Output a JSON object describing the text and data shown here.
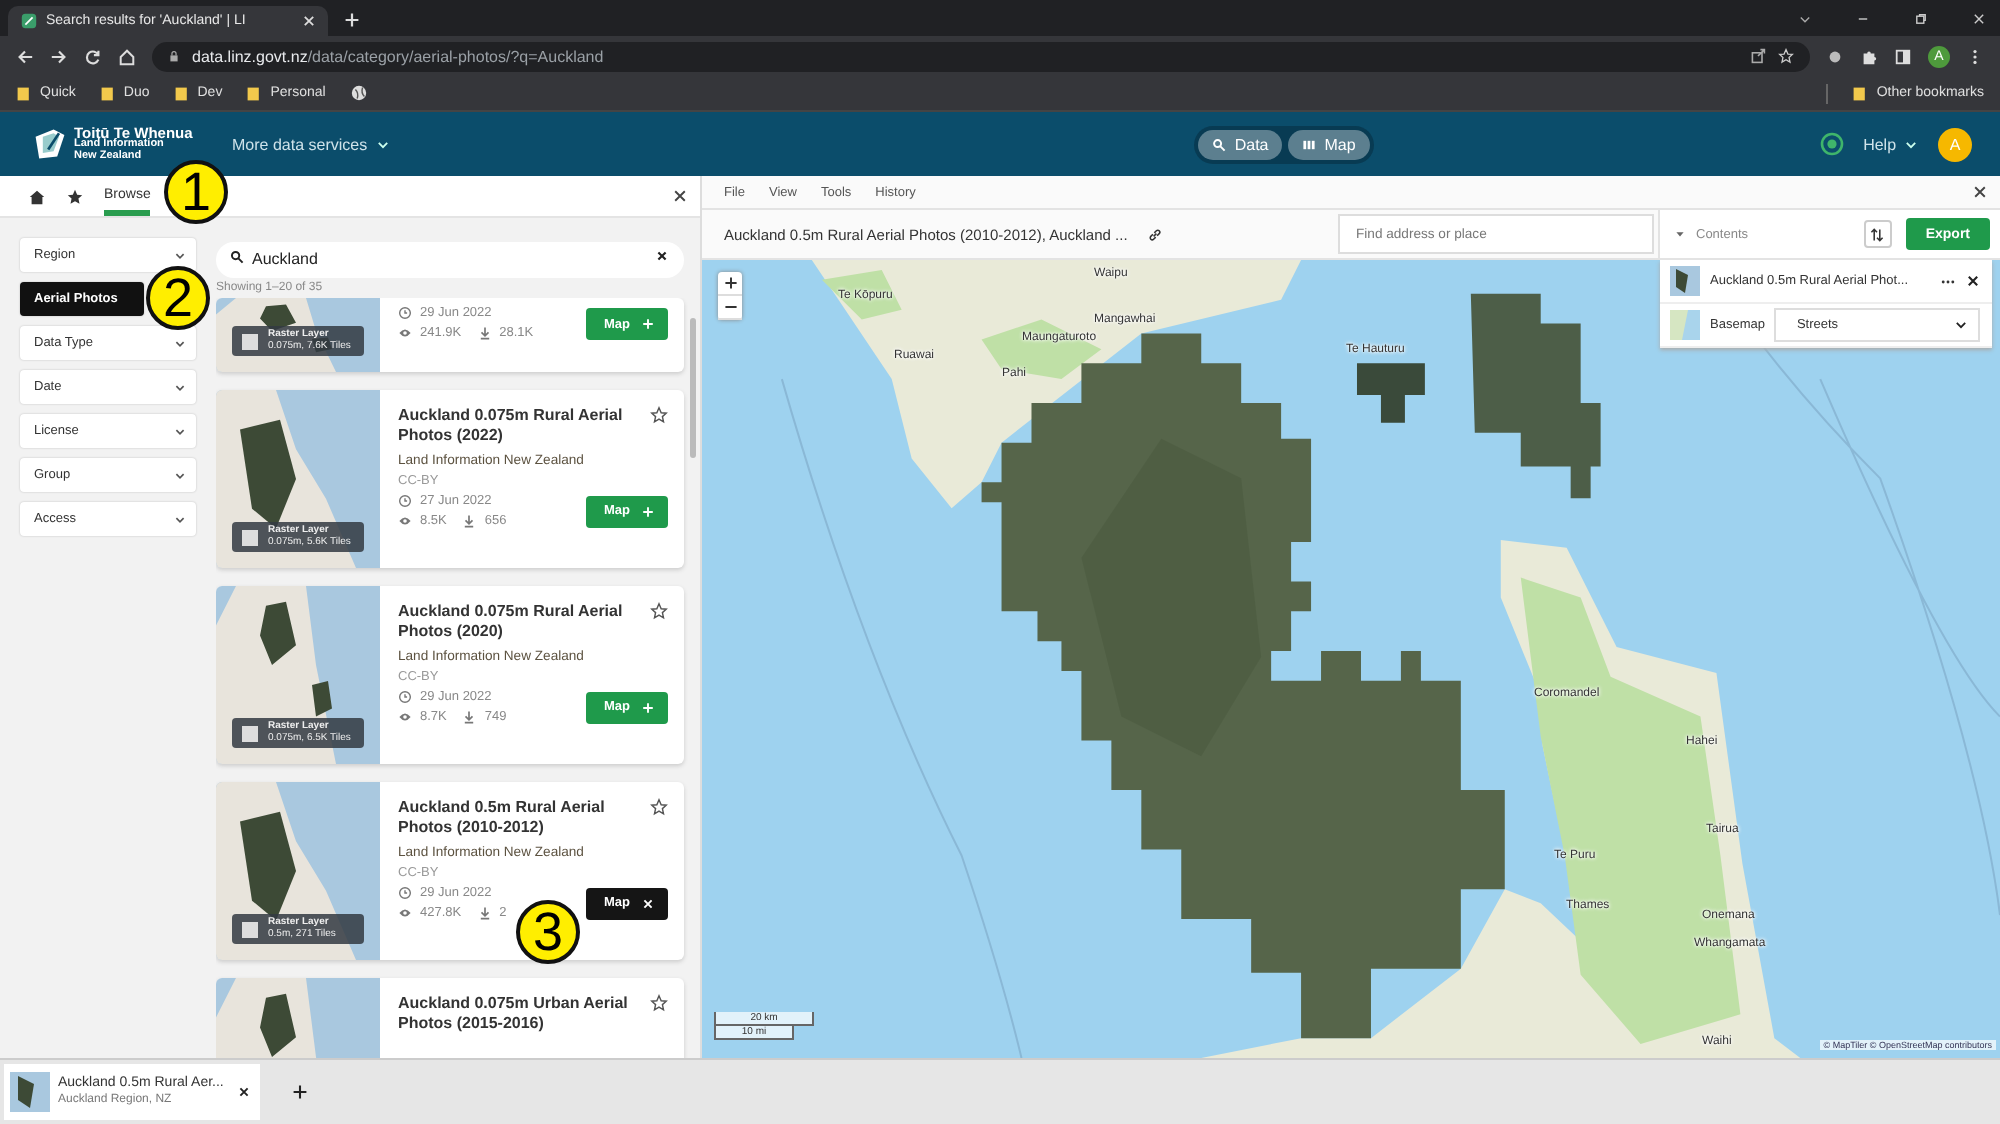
{
  "browser": {
    "tab_title": "Search results for 'Auckland' | LI",
    "url_host": "data.linz.govt.nz",
    "url_path": "/data/category/aerial-photos/?q=Auckland",
    "bookmarks": [
      "Quick",
      "Duo",
      "Dev",
      "Personal"
    ],
    "other_bookmarks": "Other bookmarks",
    "profile": "A"
  },
  "header": {
    "logo_title": "Toitū Te Whenua",
    "logo_lines": [
      "Land Information",
      "New Zealand"
    ],
    "services_menu": "More data services",
    "view_buttons": [
      "Data",
      "Map"
    ],
    "help": "Help",
    "avatar": "A"
  },
  "browse_tab": {
    "label": "Browse",
    "selected": true
  },
  "filters": [
    {
      "label": "Region",
      "selected": false
    },
    {
      "label": "Aerial Photos",
      "selected": true
    },
    {
      "label": "Data Type",
      "selected": false
    },
    {
      "label": "Date",
      "selected": false
    },
    {
      "label": "License",
      "selected": false
    },
    {
      "label": "Group",
      "selected": false
    },
    {
      "label": "Access",
      "selected": false
    }
  ],
  "search": {
    "value": "Auckland"
  },
  "results_count": "Showing 1–20 of 35",
  "results": [
    {
      "date": "29 Jun 2022",
      "views": "241.9K",
      "downloads": "28.1K",
      "layer_type": "Raster Layer",
      "layer_info": "0.075m, 7.6K Tiles",
      "map_label": "Map",
      "on_map": false
    },
    {
      "title": "Auckland 0.075m Rural Aerial Photos (2022)",
      "publisher": "Land Information New Zealand",
      "license": "CC-BY",
      "date": "27 Jun 2022",
      "views": "8.5K",
      "downloads": "656",
      "layer_type": "Raster Layer",
      "layer_info": "0.075m, 5.6K Tiles",
      "map_label": "Map",
      "on_map": false
    },
    {
      "title": "Auckland 0.075m Rural Aerial Photos (2020)",
      "publisher": "Land Information New Zealand",
      "license": "CC-BY",
      "date": "29 Jun 2022",
      "views": "8.7K",
      "downloads": "749",
      "layer_type": "Raster Layer",
      "layer_info": "0.075m, 6.5K Tiles",
      "map_label": "Map",
      "on_map": false
    },
    {
      "title": "Auckland 0.5m Rural Aerial Photos (2010-2012)",
      "publisher": "Land Information New Zealand",
      "license": "CC-BY",
      "date": "29 Jun 2022",
      "views": "427.8K",
      "downloads": "2",
      "layer_type": "Raster Layer",
      "layer_info": "0.5m, 271 Tiles",
      "map_label": "Map",
      "on_map": true
    },
    {
      "title": "Auckland 0.075m Urban Aerial Photos (2015-2016)"
    }
  ],
  "map_menu": [
    "File",
    "View",
    "Tools",
    "History"
  ],
  "map_title": "Auckland 0.5m Rural Aerial Photos (2010-2012), Auckland ...",
  "place_search": {
    "placeholder": "Find address or place"
  },
  "contents": {
    "label": "Contents",
    "export": "Export",
    "layers": [
      {
        "name": "Auckland 0.5m Rural Aerial Phot..."
      }
    ],
    "basemap_label": "Basemap",
    "basemap_value": "Streets"
  },
  "map_labels": [
    "Te Kōpuru",
    "Ruawai",
    "Pahi",
    "Maungaturoto",
    "Mangawhai",
    "Waipu",
    "Te Hauturu",
    "Coromandel",
    "Hahei",
    "Tairua",
    "Te Puru",
    "Thames",
    "Onemana",
    "Whangamata",
    "Waihi"
  ],
  "scale": [
    "20 km",
    "10 mi"
  ],
  "attribution": "© MapTiler © OpenStreetMap contributors",
  "annotations": [
    "1",
    "2",
    "3"
  ],
  "bottom_tabs": [
    {
      "title": "Auckland 0.5m Rural Aer...",
      "subtitle": "Auckland Region, NZ"
    }
  ]
}
